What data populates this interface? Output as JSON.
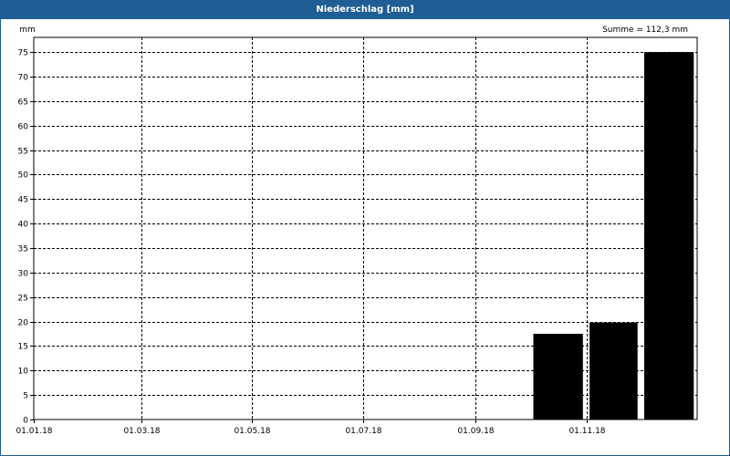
{
  "window": {
    "title": "Niederschlag [mm]"
  },
  "summary": {
    "text": "Summe = 112,3 mm"
  },
  "chart_data": {
    "type": "bar",
    "title": "Niederschlag [mm]",
    "ylabel": "mm",
    "xlabel": "",
    "x_axis": {
      "type": "date",
      "range": [
        "2018-01-01",
        "2018-12-31"
      ],
      "ticks": [
        {
          "date": "2018-01-01",
          "label": "01.01.18"
        },
        {
          "date": "2018-03-01",
          "label": "01.03.18"
        },
        {
          "date": "2018-05-01",
          "label": "01.05.18"
        },
        {
          "date": "2018-07-01",
          "label": "01.07.18"
        },
        {
          "date": "2018-09-01",
          "label": "01.09.18"
        },
        {
          "date": "2018-11-01",
          "label": "01.11.18"
        }
      ]
    },
    "ylim": [
      0,
      78
    ],
    "yticks": [
      0,
      5,
      10,
      15,
      20,
      25,
      30,
      35,
      40,
      45,
      50,
      55,
      60,
      65,
      70,
      75
    ],
    "grid": true,
    "bars": [
      {
        "start": "2018-10-01",
        "end": "2018-10-31",
        "value": 17.5
      },
      {
        "start": "2018-11-01",
        "end": "2018-11-30",
        "value": 19.8
      },
      {
        "start": "2018-12-01",
        "end": "2018-12-31",
        "value": 75.0
      }
    ],
    "colors": {
      "bar": "#000000",
      "grid": "#000000",
      "titlebar": "#1f5d95"
    }
  }
}
